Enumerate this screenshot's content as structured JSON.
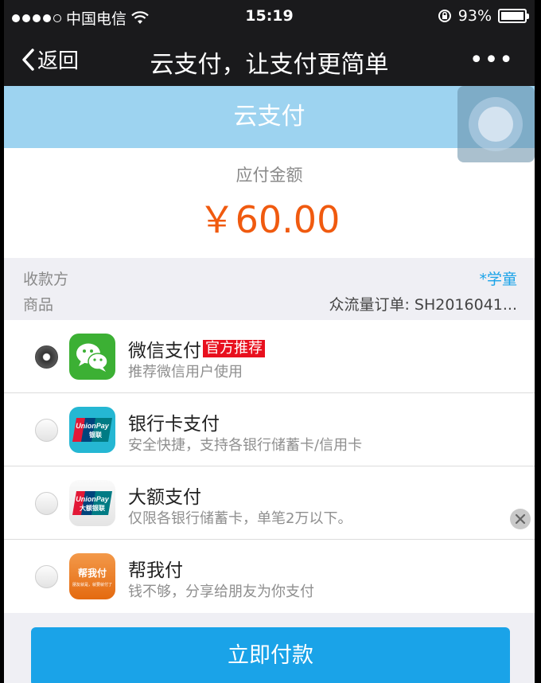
{
  "status_bar": {
    "carrier": "中国电信",
    "time": "15:19",
    "battery": "93%",
    "battery_level": 0.93
  },
  "nav": {
    "back_label": "返回",
    "title": "云支付，让支付更简单",
    "more_label": "•••"
  },
  "header": {
    "title": "云支付"
  },
  "amount": {
    "label": "应付金额",
    "value": "￥60.00"
  },
  "info": {
    "payee_label": "收款方",
    "payee_value": "*学童",
    "goods_label": "商品",
    "goods_value": "众流量订单: SH2016041..."
  },
  "options": [
    {
      "title": "微信支付",
      "badge": "官方推荐",
      "desc": "推荐微信用户使用",
      "icon": "wechat-icon",
      "selected": true
    },
    {
      "title": "银行卡支付",
      "desc": "安全快捷，支持各银行储蓄卡/信用卡",
      "icon": "unionpay-icon",
      "selected": false
    },
    {
      "title": "大额支付",
      "desc": "仅限各银行储蓄卡，单笔2万以下。",
      "icon": "unionpay-large-icon",
      "selected": false
    },
    {
      "title": "帮我付",
      "desc": "钱不够，分享给朋友为你支付",
      "icon": "help-pay-icon",
      "icon_text": "帮我付",
      "icon_sub": "朋友就是，就要就付了",
      "selected": false
    }
  ],
  "unionpay_text": "UnionPay",
  "unionpay_sub1": "银联",
  "unionpay_sub2": "大额银联",
  "pay_button": "立即付款",
  "colors": {
    "accent": "#1aa3e8",
    "amount": "#f05a0f",
    "header": "#9dd3f0",
    "badge": "#e8101e"
  }
}
